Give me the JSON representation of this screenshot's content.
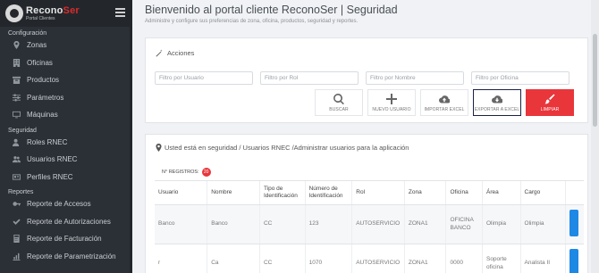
{
  "brand": {
    "name_part1": "Recono",
    "name_part2": "Ser",
    "subtitle": "Portal Clientes"
  },
  "sidebar": {
    "sections": [
      {
        "title": "Configuración",
        "items": [
          {
            "label": "Zonas",
            "icon": "map-marker-icon"
          },
          {
            "label": "Oficinas",
            "icon": "building-icon"
          },
          {
            "label": "Productos",
            "icon": "box-icon"
          },
          {
            "label": "Parámetros",
            "icon": "sliders-icon"
          },
          {
            "label": "Máquinas",
            "icon": "monitor-icon"
          }
        ]
      },
      {
        "title": "Seguridad",
        "items": [
          {
            "label": "Roles RNEC",
            "icon": "user-tag-icon"
          },
          {
            "label": "Usuarios RNEC",
            "icon": "users-icon"
          },
          {
            "label": "Perfiles RNEC",
            "icon": "id-card-icon"
          }
        ]
      },
      {
        "title": "Reportes",
        "items": [
          {
            "label": "Reporte de Accesos",
            "icon": "key-icon"
          },
          {
            "label": "Reporte de Autorizaciones",
            "icon": "check-icon"
          },
          {
            "label": "Reporte de Facturación",
            "icon": "calculator-icon"
          },
          {
            "label": "Reporte de Parametrización",
            "icon": "chart-icon"
          }
        ]
      }
    ]
  },
  "header": {
    "title": "Bienvenido al portal cliente ReconoSer | Seguridad",
    "subtitle": "Administre y configure sus preferencias de zona, oficina, productos, seguridad y reportes."
  },
  "actions": {
    "heading": "Acciones",
    "filters": [
      {
        "placeholder": "Filtro por Usuario"
      },
      {
        "placeholder": "Filtro por Rol"
      },
      {
        "placeholder": "Filtro por Nombre"
      },
      {
        "placeholder": "Filtro por Oficina"
      }
    ],
    "buttons": {
      "buscar": "BUSCAR",
      "nuevo": "NUEVO USUARIO",
      "importar": "IMPORTAR EXCEL",
      "exportar": "EXPORTAR A EXCEL",
      "limpiar": "LIMPIAR"
    }
  },
  "table_card": {
    "breadcrumb": "Usted está en seguridad / Usuarios RNEC /Administrar usuarios para la aplicación",
    "registros_label": "N° REGISTROS:",
    "registros_count": "20",
    "columns": [
      "Usuario",
      "Nombre",
      "Tipo de Identificación",
      "Número de Identificación",
      "Rol",
      "Zona",
      "Oficina",
      "Área",
      "Cargo"
    ],
    "rows": [
      [
        "Banco",
        "Banco",
        "CC",
        "123",
        "AUTOSERVICIO",
        "ZONA1",
        "OFICINA BANCO",
        "Olimpia",
        "Olimpia"
      ],
      [
        "r",
        "Ca",
        "CC",
        "1070",
        "AUTOSERVICIO",
        "ZONA1",
        "0000",
        "Soporte oficina",
        "Analista II"
      ]
    ]
  },
  "colors": {
    "accent": "#e8363b",
    "sidebar_bg": "#2b3036",
    "action_blue": "#1e88e5",
    "selected_border": "#1a2145"
  }
}
